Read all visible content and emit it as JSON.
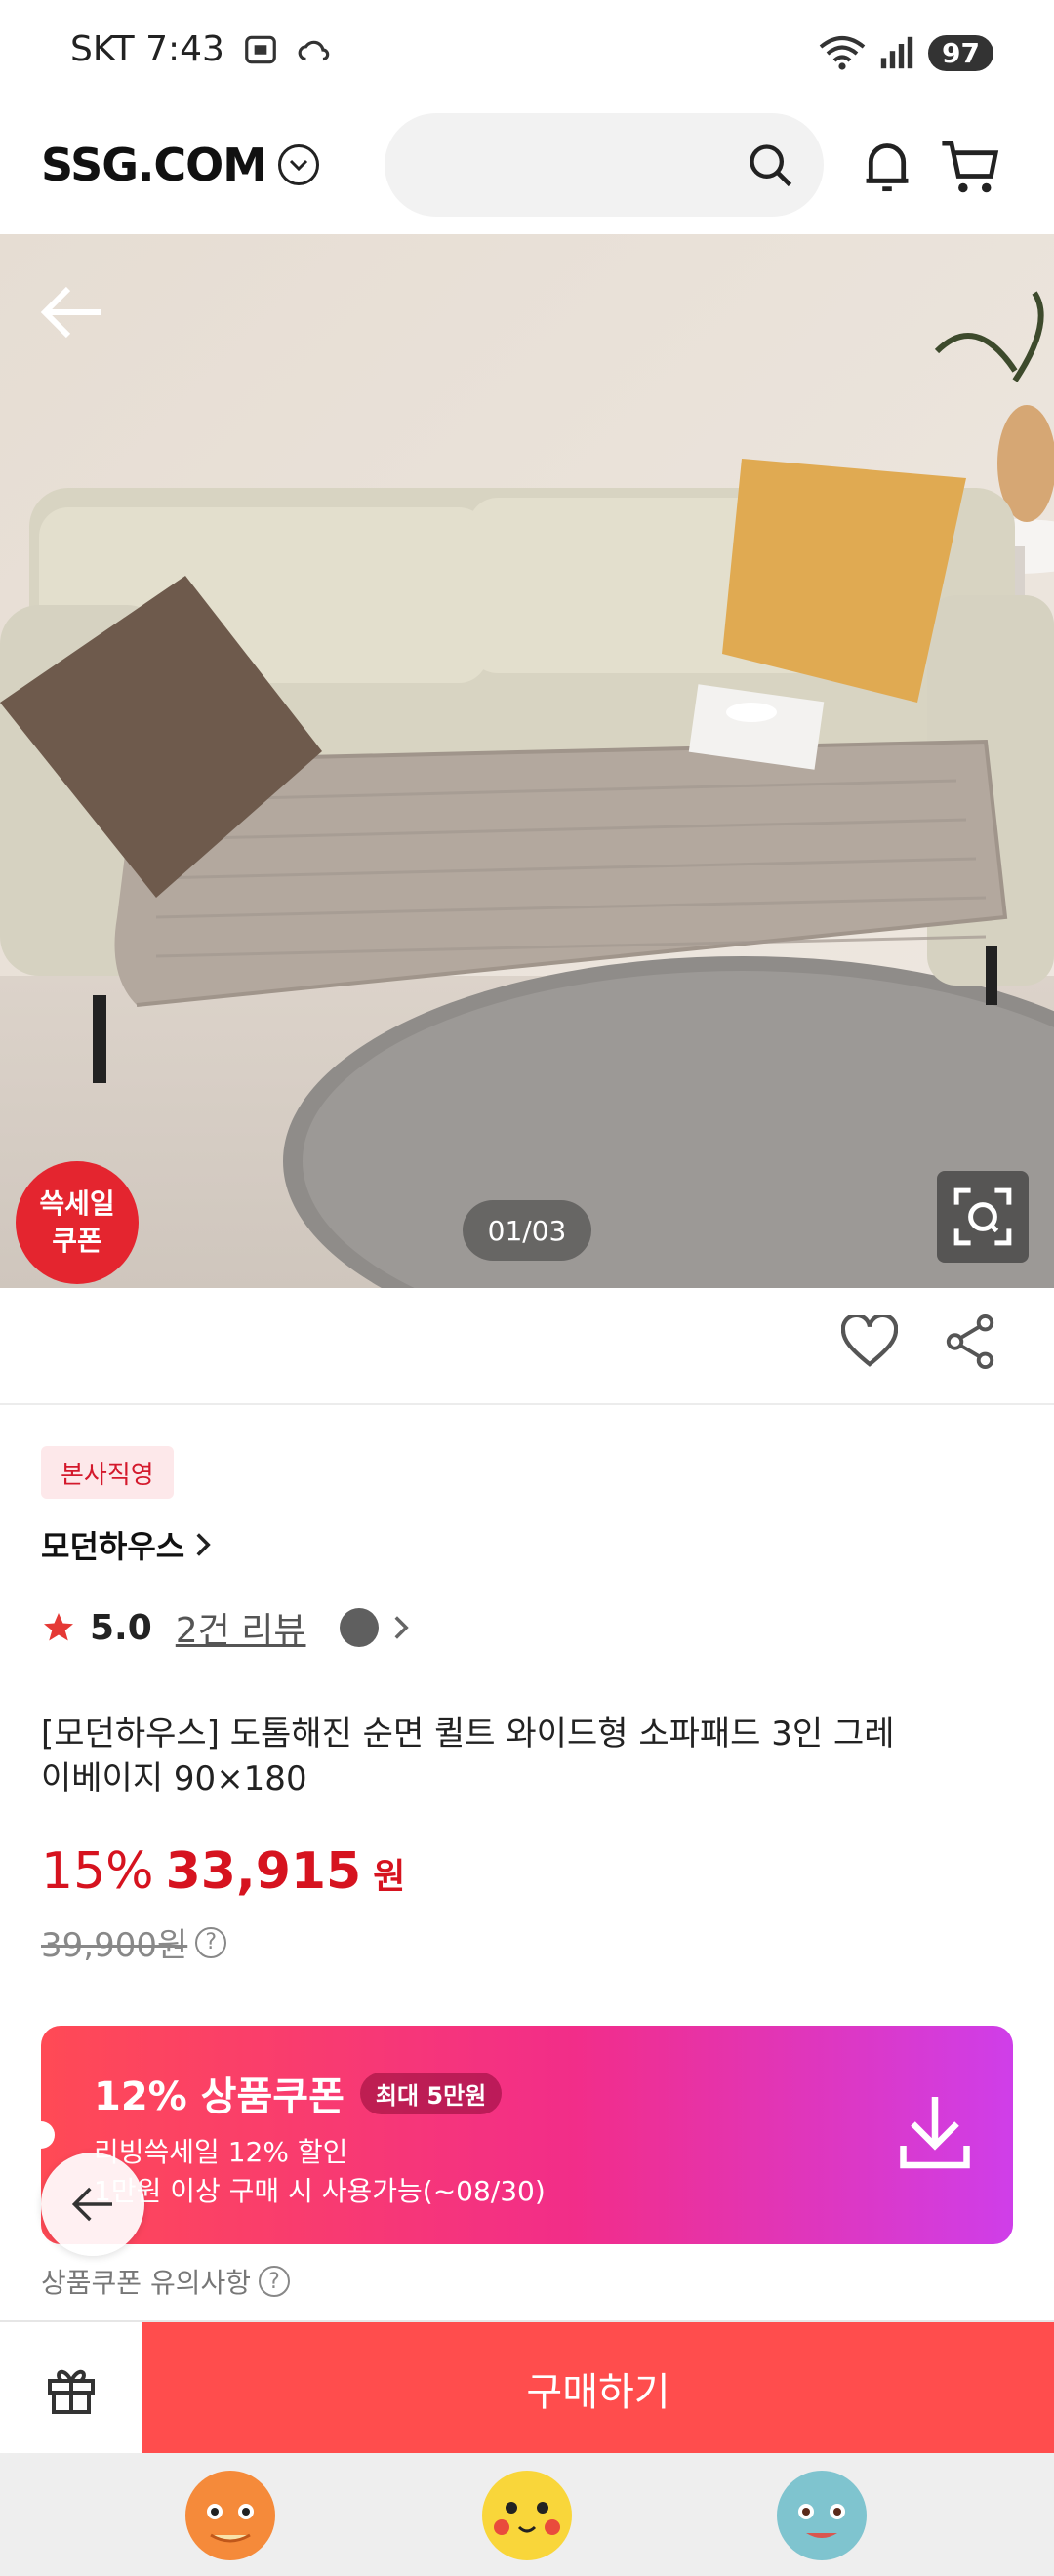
{
  "status_bar": {
    "carrier_time": "SKT 7:43",
    "battery": "97"
  },
  "header": {
    "logo": "SSG.COM",
    "search": {
      "value": "",
      "placeholder": ""
    }
  },
  "hero": {
    "sale_badge_line1": "쓱세일",
    "sale_badge_line2": "쿠폰",
    "page_indicator": "01/03"
  },
  "product": {
    "tag": "본사직영",
    "brand": "모던하우스",
    "rating": "5.0",
    "reviews": "2건 리뷰",
    "title": "[모던하우스] 도톰해진 순면 퀼트 와이드형 소파패드 3인 그레이베이지 90×180",
    "discount": "15%",
    "price": "33,915",
    "currency": "원",
    "original_price": "39,900원"
  },
  "coupon": {
    "title": "12% 상품쿠폰",
    "chip": "최대 5만원",
    "line1": "리빙쓱세일 12% 할인",
    "line2": "1만원 이상 구매 시 사용가능(~08/30)",
    "notice": "상품쿠폰 유의사항"
  },
  "bottom_bar": {
    "buy_label": "구매하기"
  },
  "colors": {
    "accent_red": "#d6131f",
    "buy_button": "#ff4d4d",
    "coupon_gradient_start": "#ff4a55",
    "coupon_gradient_end": "#cf3ee9"
  },
  "icons": [
    "camera-icon",
    "cloud-icon",
    "wifi-icon",
    "signal-icon",
    "chevron-down-icon",
    "search-icon",
    "bell-icon",
    "cart-icon",
    "back-arrow-icon",
    "lens-search-icon",
    "heart-icon",
    "share-icon",
    "chevron-right-icon",
    "star-icon",
    "download-icon",
    "gift-icon"
  ]
}
